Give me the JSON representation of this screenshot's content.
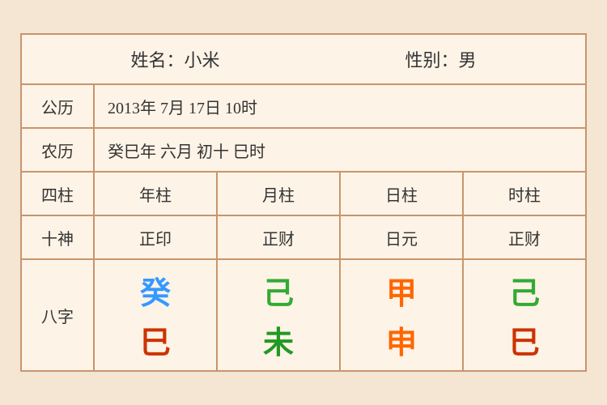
{
  "header": {
    "name_label": "姓名：小米",
    "gender_label": "性别：男"
  },
  "rows": {
    "solar": {
      "label": "公历",
      "content": "2013年 7月 17日 10时"
    },
    "lunar": {
      "label": "农历",
      "content": "癸巳年 六月 初十 巳时"
    }
  },
  "pillars": {
    "label": "四柱",
    "cells": [
      "年柱",
      "月柱",
      "日柱",
      "时柱"
    ]
  },
  "shishen": {
    "label": "十神",
    "cells": [
      "正印",
      "正财",
      "日元",
      "正财"
    ]
  },
  "bazhi": {
    "label": "八字",
    "columns": [
      {
        "top": "癸",
        "top_color": "blue",
        "bottom": "巳",
        "bottom_color": "red"
      },
      {
        "top": "己",
        "top_color": "green",
        "bottom": "未",
        "bottom_color": "dark-green"
      },
      {
        "top": "甲",
        "top_color": "orange",
        "bottom": "申",
        "bottom_color": "orange"
      },
      {
        "top": "己",
        "top_color": "green",
        "bottom": "巳",
        "bottom_color": "red"
      }
    ]
  }
}
